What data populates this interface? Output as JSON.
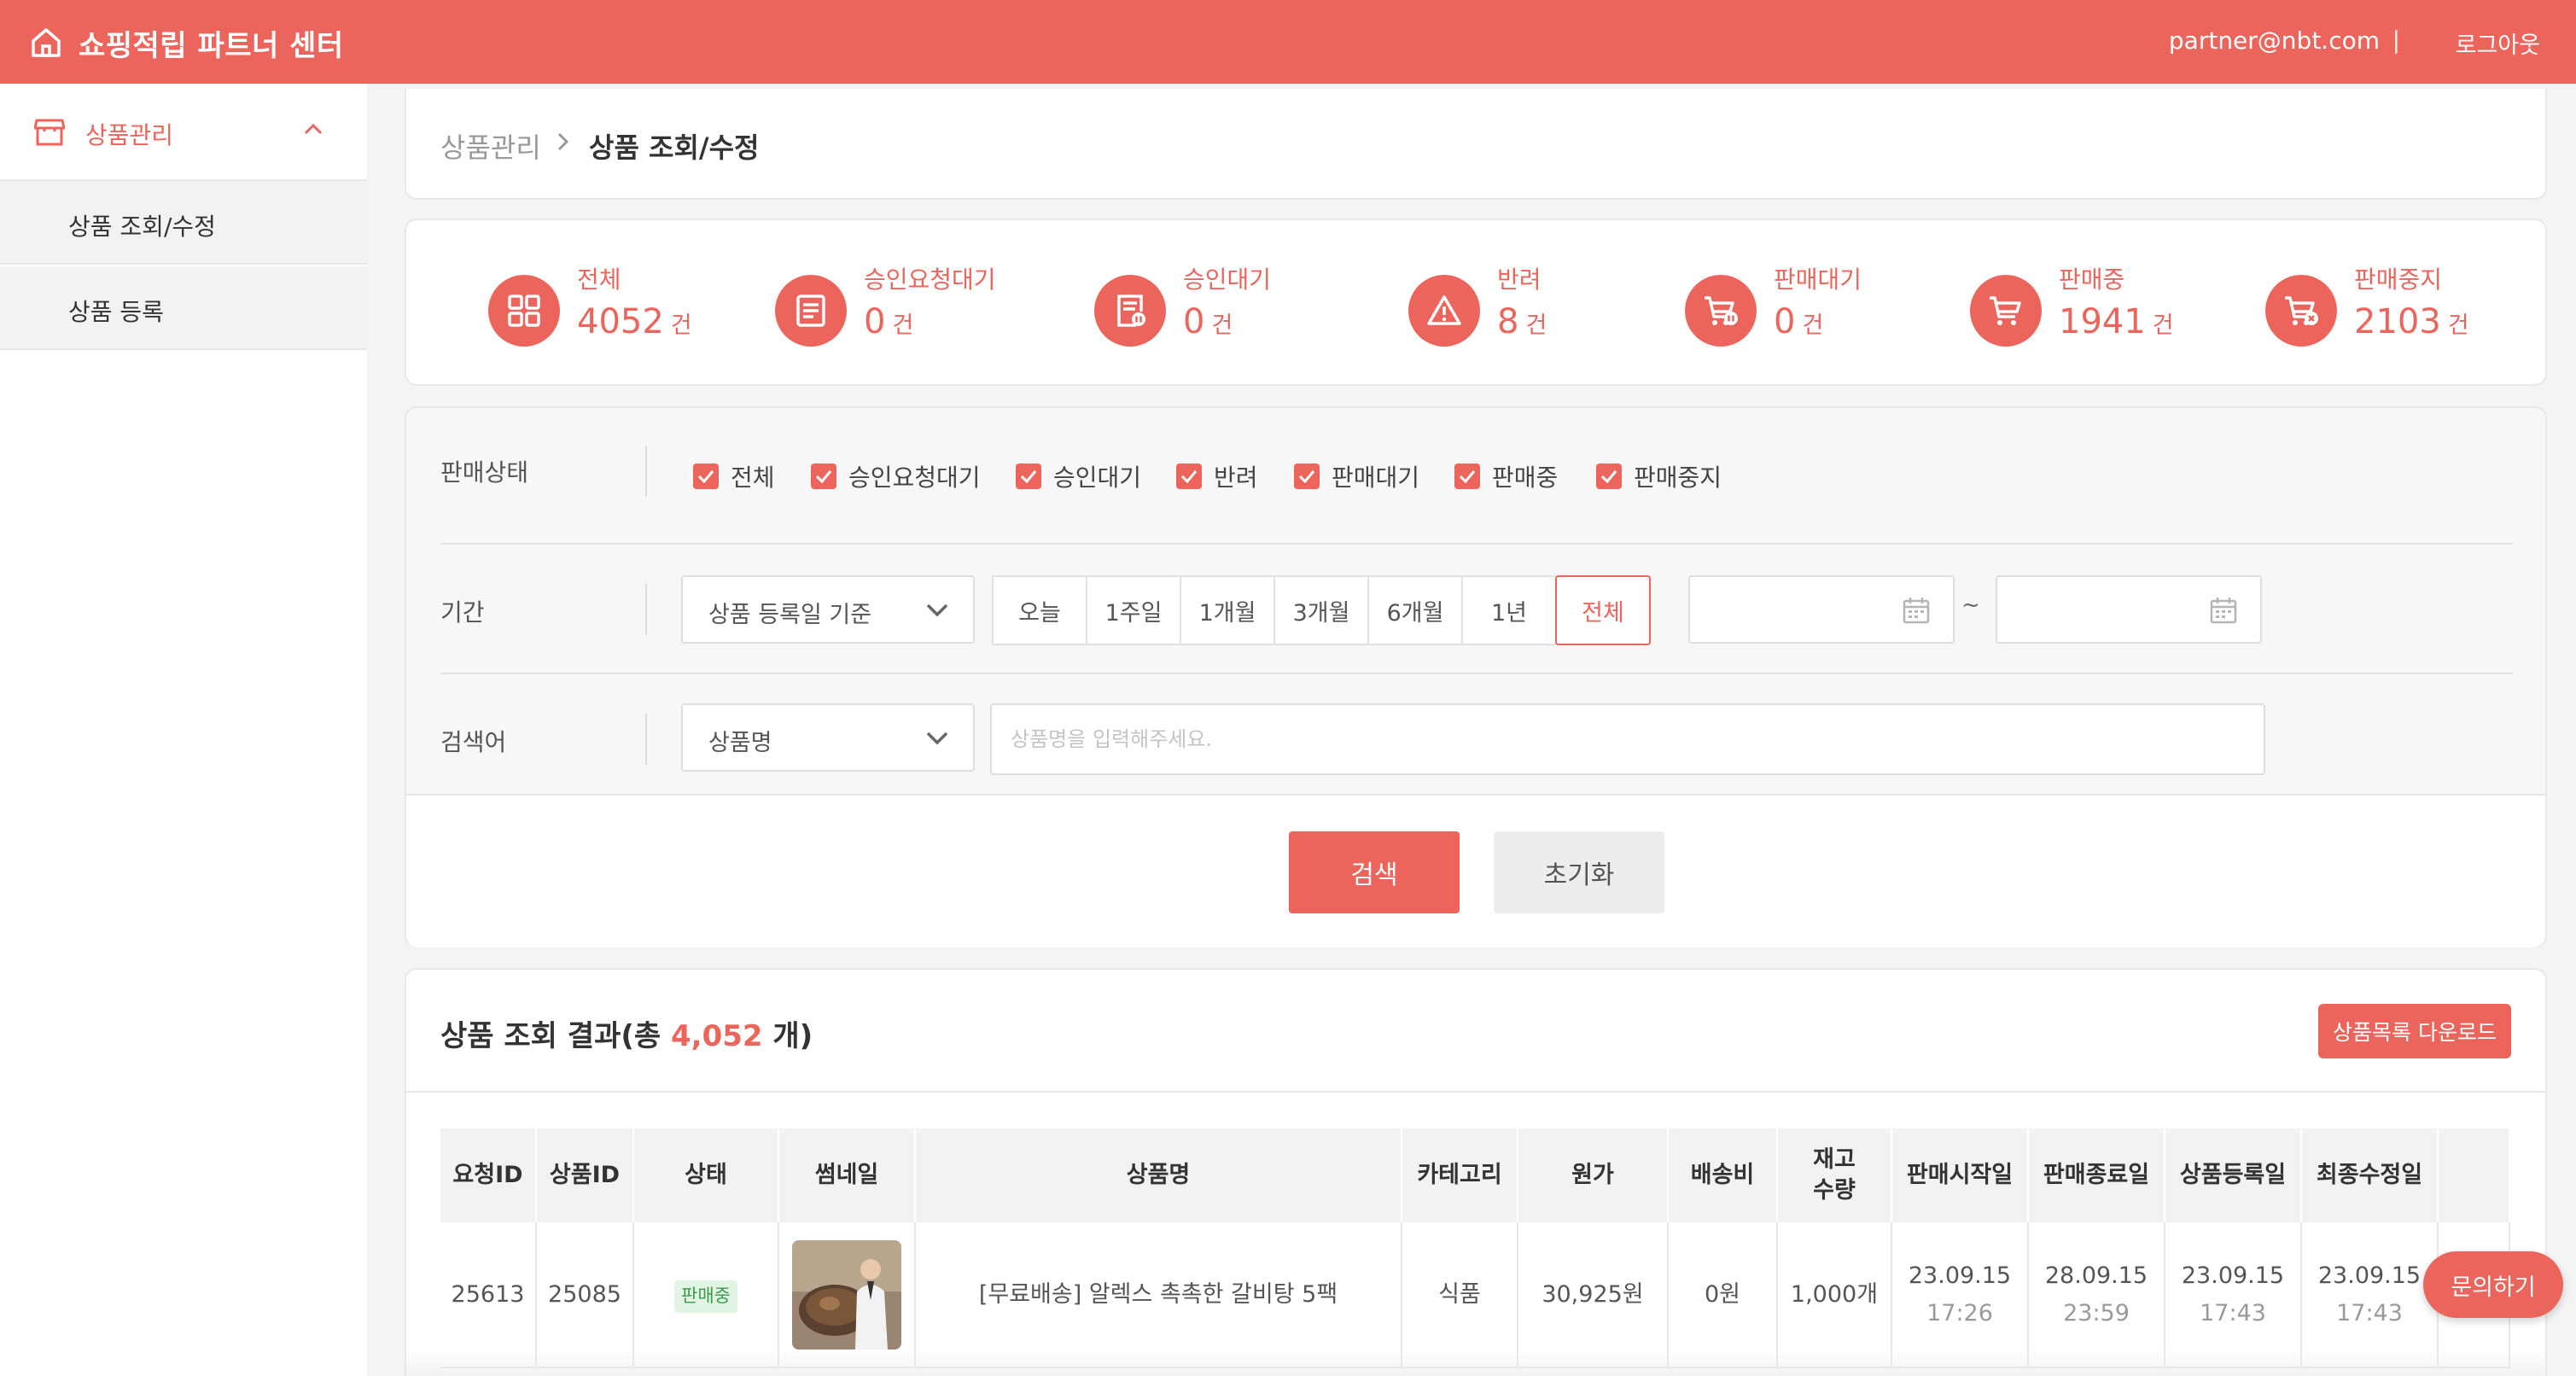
{
  "header": {
    "brand": "쇼핑적립 파트너 센터",
    "user_email": "partner@nbt.com",
    "separator": "|",
    "logout": "로그아웃",
    "home_icon": "home-icon"
  },
  "sidebar": {
    "section_label": "상품관리",
    "items": [
      {
        "label": "상품 조회/수정"
      },
      {
        "label": "상품 등록"
      }
    ]
  },
  "breadcrumb": {
    "parent": "상품관리",
    "current": "상품 조회/수정"
  },
  "stats": [
    {
      "title": "전체",
      "value": "4052",
      "unit": "건",
      "icon": "grid-icon"
    },
    {
      "title": "승인요청대기",
      "value": "0",
      "unit": "건",
      "icon": "document-icon"
    },
    {
      "title": "승인대기",
      "value": "0",
      "unit": "건",
      "icon": "document-pause-icon"
    },
    {
      "title": "반려",
      "value": "8",
      "unit": "건",
      "icon": "warning-icon"
    },
    {
      "title": "판매대기",
      "value": "0",
      "unit": "건",
      "icon": "cart-pause-icon"
    },
    {
      "title": "판매중",
      "value": "1941",
      "unit": "건",
      "icon": "cart-icon"
    },
    {
      "title": "판매중지",
      "value": "2103",
      "unit": "건",
      "icon": "cart-stop-icon"
    }
  ],
  "filters": {
    "status_label": "판매상태",
    "statuses": [
      "전체",
      "승인요청대기",
      "승인대기",
      "반려",
      "판매대기",
      "판매중",
      "판매중지"
    ],
    "period_label": "기간",
    "period_basis": "상품 등록일 기준",
    "periods": [
      "오늘",
      "1주일",
      "1개월",
      "3개월",
      "6개월",
      "1년",
      "전체"
    ],
    "period_active": "전체",
    "date_tilde": "~",
    "keyword_label": "검색어",
    "keyword_field": "상품명",
    "keyword_placeholder": "상품명을 입력해주세요.",
    "search_button": "검색",
    "reset_button": "초기화"
  },
  "results": {
    "title_prefix": "상품 조회 결과(총 ",
    "count": "4,052",
    "title_suffix": " 개)",
    "download_button": "상품목록 다운로드",
    "columns": [
      "요청ID",
      "상품ID",
      "상태",
      "썸네일",
      "상품명",
      "카테고리",
      "원가",
      "배송비",
      "재고\n수량",
      "판매시작일",
      "판매종료일",
      "상품등록일",
      "최종수정일"
    ],
    "rows": [
      {
        "request_id": "25613",
        "product_id": "25085",
        "status": "판매중",
        "name": "[무료배송] 알렉스 촉촉한 갈비탕 5팩",
        "category": "식품",
        "cost": "30,925원",
        "shipping": "0원",
        "stock": "1,000개",
        "sale_start_date": "23.09.15",
        "sale_start_time": "17:26",
        "sale_end_date": "28.09.15",
        "sale_end_time": "23:59",
        "registered_date": "23.09.15",
        "registered_time": "17:43",
        "modified_date": "23.09.15",
        "modified_time": "17:43"
      }
    ]
  },
  "floating_button": "문의하기",
  "colors": {
    "accent": "#ec655c",
    "background": "#f4f4f4",
    "badge_green": "#3c9a4a"
  }
}
